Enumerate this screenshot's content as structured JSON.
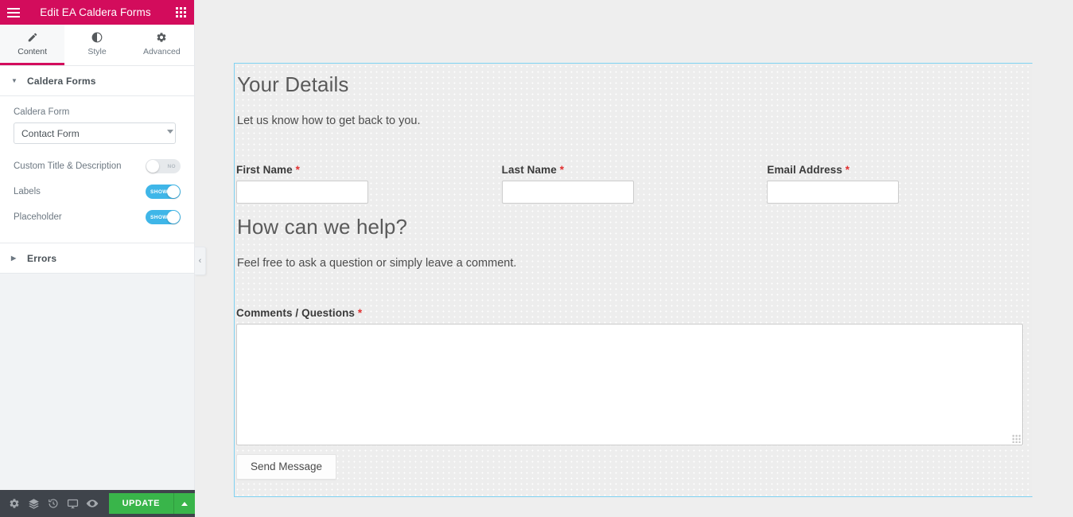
{
  "panel": {
    "header": {
      "title": "Edit EA Caldera Forms",
      "menu_icon": "hamburger-icon",
      "grid_icon": "widgets-grid-icon",
      "bg_color": "#d30c5c"
    },
    "tabs": [
      {
        "label": "Content",
        "icon": "pencil-icon",
        "active": true
      },
      {
        "label": "Style",
        "icon": "contrast-icon",
        "active": false
      },
      {
        "label": "Advanced",
        "icon": "gear-icon",
        "active": false
      }
    ],
    "sections": [
      {
        "title": "Caldera Forms",
        "expanded": true
      },
      {
        "title": "Errors",
        "expanded": false
      }
    ],
    "controls": {
      "caldera_form": {
        "label": "Caldera Form",
        "value": "Contact Form",
        "options": [
          "Contact Form"
        ]
      },
      "custom_title_description": {
        "label": "Custom Title & Description",
        "state": "off",
        "state_text": "NO"
      },
      "labels": {
        "label": "Labels",
        "state": "on",
        "state_text": "SHOW"
      },
      "placeholder": {
        "label": "Placeholder",
        "state": "on",
        "state_text": "SHOW"
      }
    },
    "footer": {
      "icons": [
        "settings-gear-icon",
        "navigator-layers-icon",
        "history-revisions-icon",
        "responsive-mode-icon",
        "preview-eye-icon"
      ],
      "update_label": "UPDATE",
      "update_color": "#39b54a",
      "caret_icon": "caret-up-icon"
    },
    "collapse_handle_icon": "chevron-left-icon"
  },
  "canvas": {
    "selection_outline_color": "#7fd2f2",
    "form": {
      "sections": [
        {
          "title": "Your Details",
          "description": "Let us know how to get back to you."
        },
        {
          "title": "How can we help?",
          "description": "Feel free to ask a question or simply leave a comment."
        }
      ],
      "fields": [
        {
          "label": "First Name",
          "required": true,
          "required_mark": "*",
          "type": "text",
          "value": "",
          "placeholder": ""
        },
        {
          "label": "Last Name",
          "required": true,
          "required_mark": "*",
          "type": "text",
          "value": "",
          "placeholder": ""
        },
        {
          "label": "Email Address",
          "required": true,
          "required_mark": "*",
          "type": "text",
          "value": "",
          "placeholder": ""
        },
        {
          "label": "Comments / Questions",
          "required": true,
          "required_mark": "*",
          "type": "textarea",
          "value": "",
          "placeholder": ""
        }
      ],
      "submit_label": "Send Message"
    }
  }
}
